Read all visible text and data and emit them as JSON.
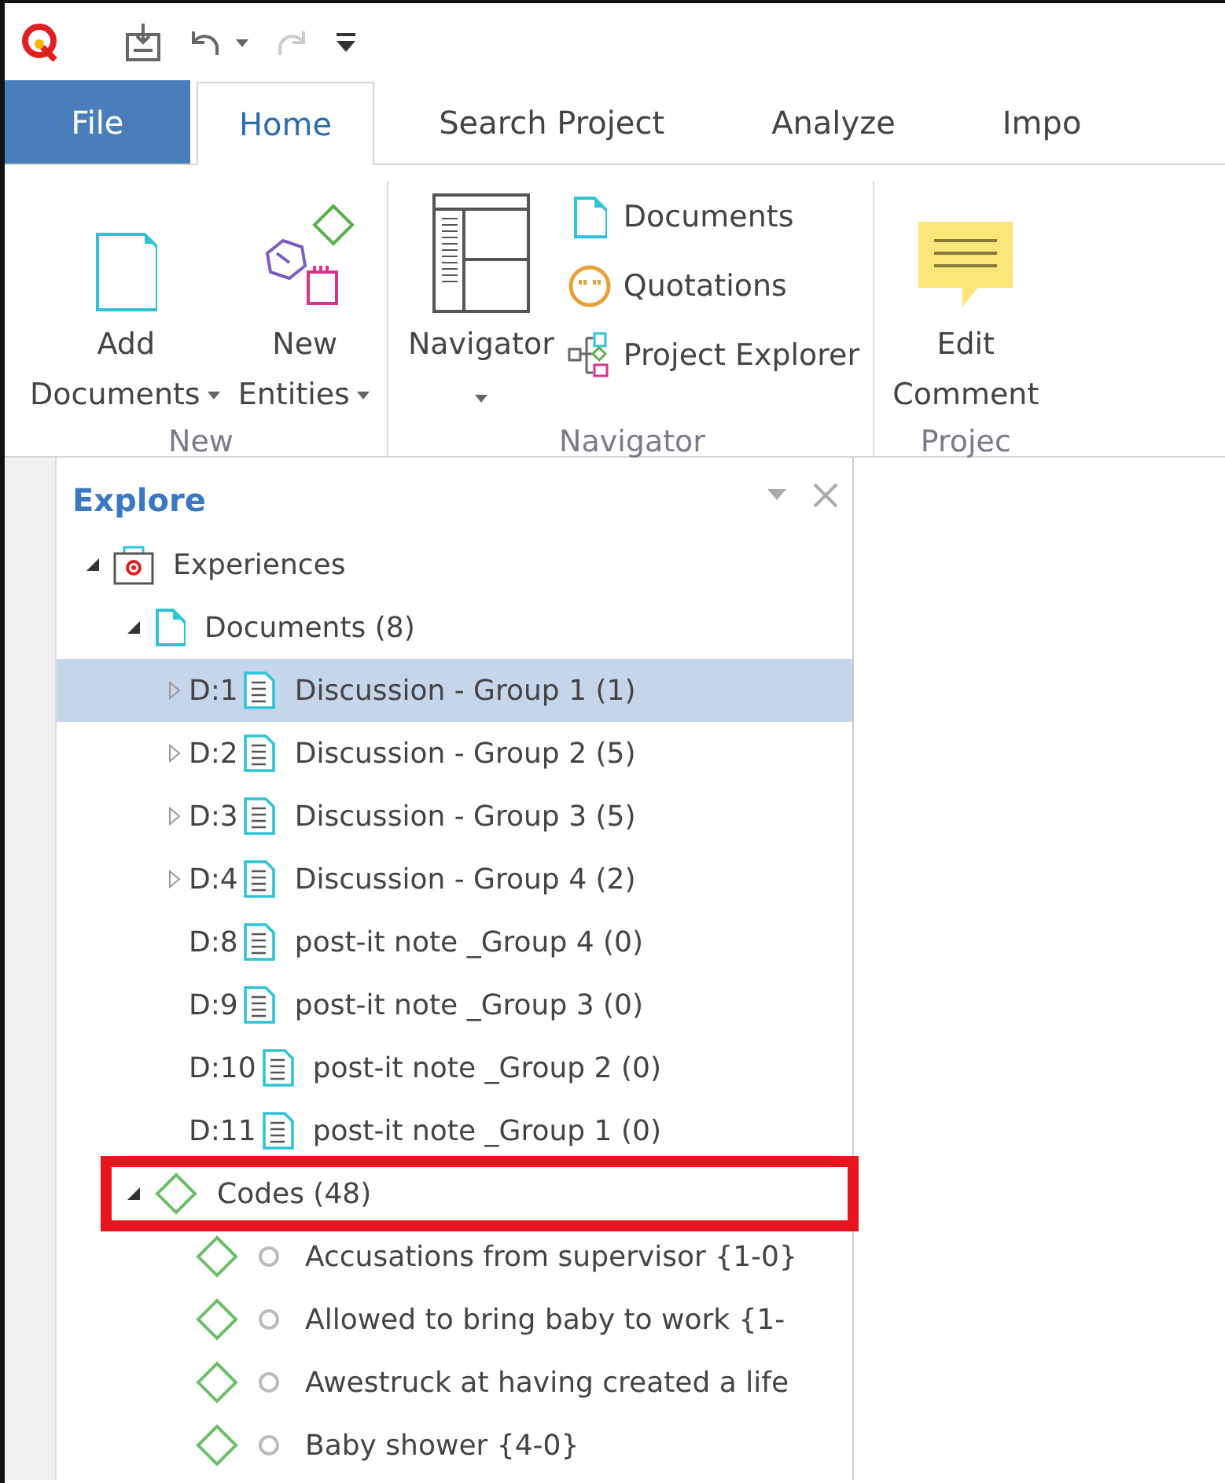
{
  "tabs": [
    {
      "label": "File",
      "kind": "file",
      "selected": false
    },
    {
      "label": "Home",
      "kind": "tab",
      "selected": true
    },
    {
      "label": "Search Project",
      "kind": "tab",
      "selected": false
    },
    {
      "label": "Analyze",
      "kind": "tab",
      "selected": false
    },
    {
      "label": "Impo",
      "kind": "tab",
      "selected": false
    }
  ],
  "quick_access": {
    "redo_disabled": true
  },
  "ribbon_groups": [
    {
      "label": "New",
      "buttons": [
        {
          "kind": "large",
          "lines": [
            "Add",
            "Documents"
          ],
          "dropdown": true
        },
        {
          "kind": "large",
          "lines": [
            "New",
            "Entities"
          ],
          "dropdown": true
        }
      ]
    },
    {
      "label": "Navigator",
      "buttons": [
        {
          "kind": "large",
          "lines": [
            "Navigator"
          ],
          "dropdown": true
        },
        {
          "kind": "small",
          "lines": [
            "Documents"
          ]
        },
        {
          "kind": "small",
          "lines": [
            "Quotations"
          ]
        },
        {
          "kind": "small",
          "lines": [
            "Project Explorer"
          ]
        }
      ]
    },
    {
      "label": "Projec",
      "buttons": [
        {
          "kind": "large",
          "lines": [
            "Edit",
            "Comment"
          ]
        }
      ]
    }
  ],
  "panel": {
    "title": "Explore",
    "tree": [
      {
        "kind": "project",
        "label": "Experiences",
        "expanded": true,
        "selected": false,
        "highlighted": false,
        "children": [
          {
            "kind": "folder",
            "label": "Documents (8)",
            "expanded": true,
            "selected": false,
            "highlighted": false,
            "children": [
              {
                "kind": "document",
                "prefix": "D:1",
                "label": "Discussion - Group 1 (1)",
                "expanded": false,
                "selected": true,
                "highlighted": false
              },
              {
                "kind": "document",
                "prefix": "D:2",
                "label": "Discussion - Group 2 (5)",
                "expanded": false,
                "selected": false,
                "highlighted": false
              },
              {
                "kind": "document",
                "prefix": "D:3",
                "label": "Discussion - Group 3 (5)",
                "expanded": false,
                "selected": false,
                "highlighted": false
              },
              {
                "kind": "document",
                "prefix": "D:4",
                "label": "Discussion - Group 4 (2)",
                "expanded": false,
                "selected": false,
                "highlighted": false
              },
              {
                "kind": "document",
                "prefix": "D:8",
                "label": "post-it note _Group 4 (0)",
                "selected": false,
                "highlighted": false
              },
              {
                "kind": "document",
                "prefix": "D:9",
                "label": "post-it note _Group 3 (0)",
                "selected": false,
                "highlighted": false
              },
              {
                "kind": "document",
                "prefix": "D:10",
                "label": "post-it note _Group 2 (0)",
                "selected": false,
                "highlighted": false
              },
              {
                "kind": "document",
                "prefix": "D:11",
                "label": "post-it note _Group 1 (0)",
                "selected": false,
                "highlighted": false
              }
            ]
          },
          {
            "kind": "codes",
            "label": "Codes (48)",
            "expanded": true,
            "selected": false,
            "highlighted": true,
            "children": [
              {
                "kind": "code",
                "label": "Accusations from supervisor {1-0}",
                "selected": false,
                "highlighted": false
              },
              {
                "kind": "code",
                "label": "Allowed to bring baby to work {1-",
                "selected": false,
                "highlighted": false
              },
              {
                "kind": "code",
                "label": "Awestruck at having created a life",
                "selected": false,
                "highlighted": false
              },
              {
                "kind": "code",
                "label": "Baby shower {4-0}",
                "selected": false,
                "highlighted": false
              }
            ]
          }
        ]
      }
    ]
  }
}
